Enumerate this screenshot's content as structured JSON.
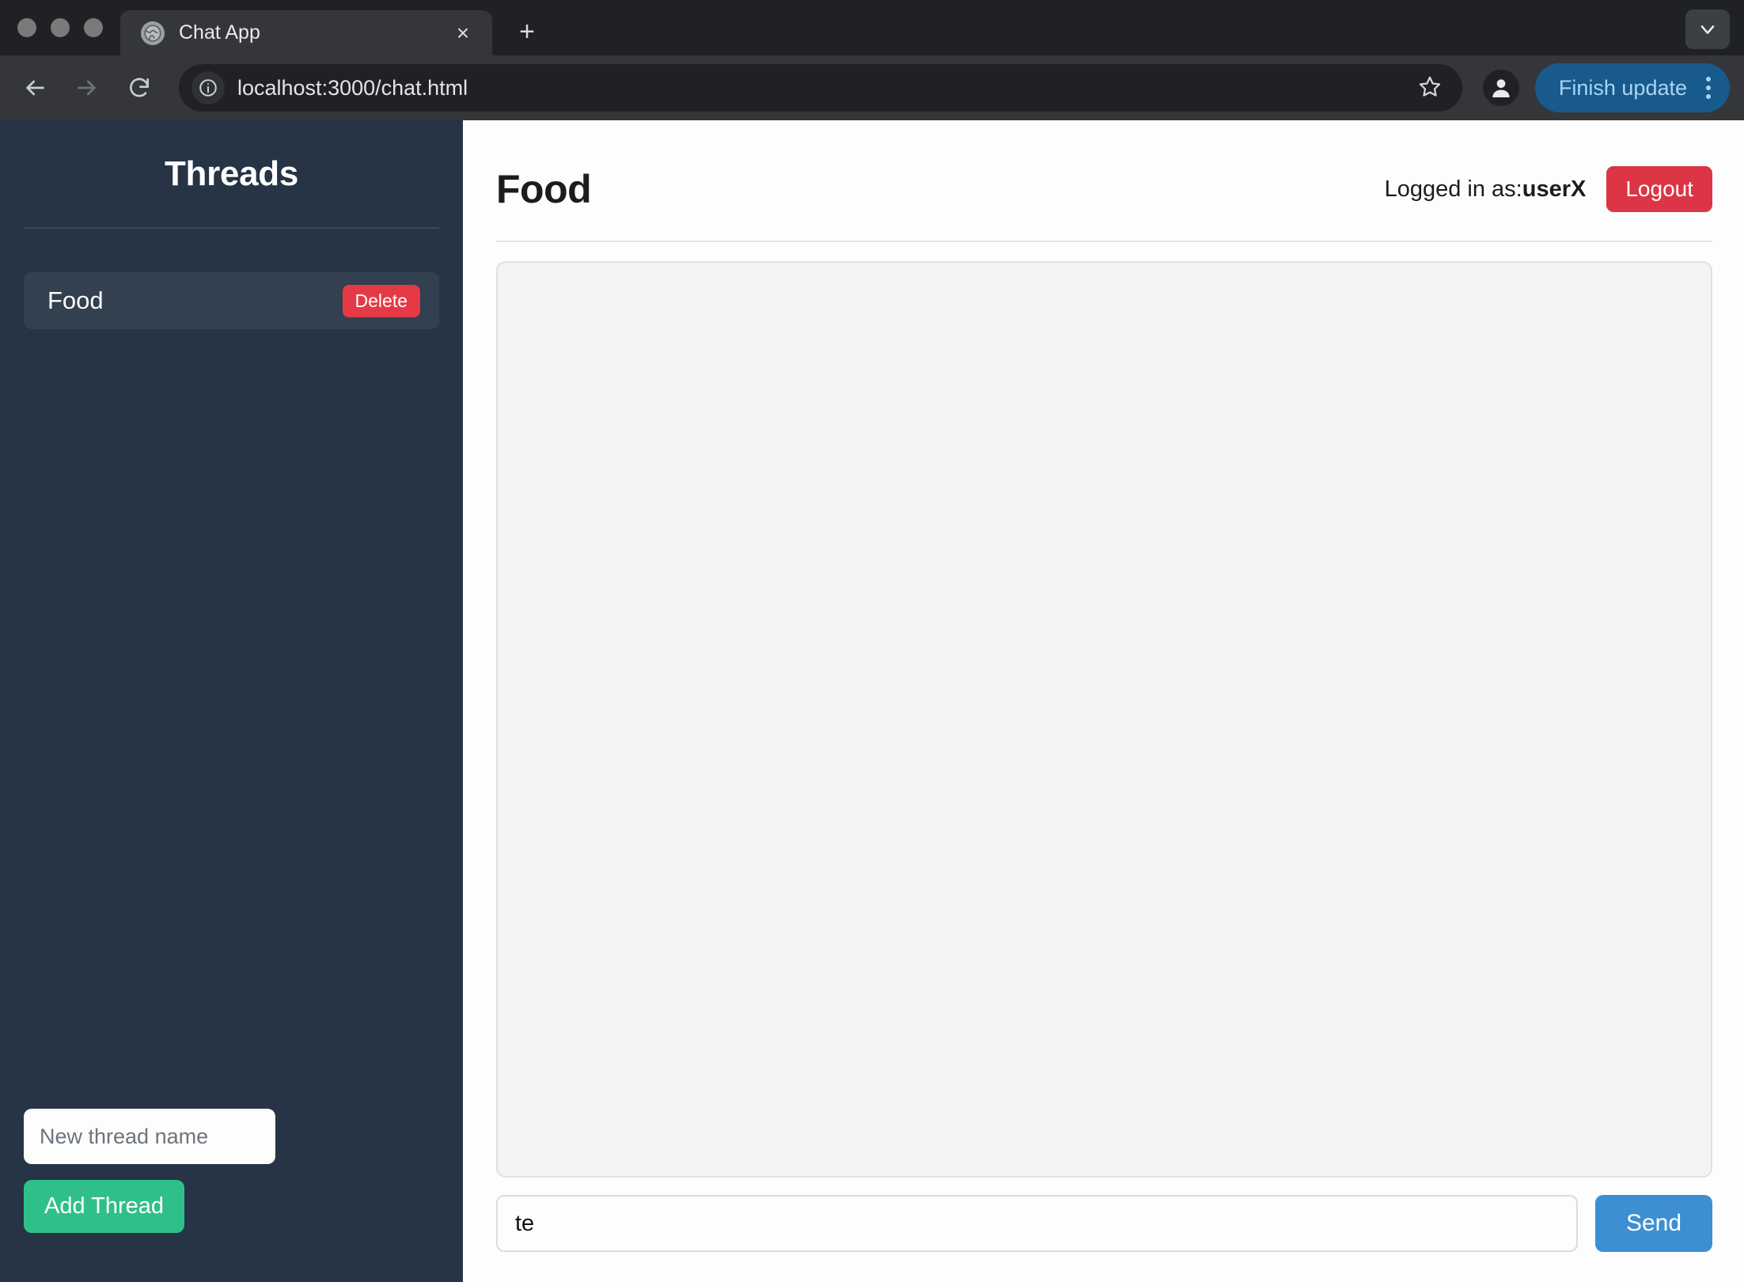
{
  "browser": {
    "traffic_lights": [
      "close",
      "minimize",
      "maximize"
    ],
    "tab": {
      "title": "Chat App",
      "favicon": "globe-icon",
      "close_label": "×"
    },
    "new_tab_label": "+",
    "tab_list_chevron": "chevron-down-icon",
    "toolbar": {
      "back": "back-arrow-icon",
      "forward": "forward-arrow-icon",
      "reload": "reload-icon",
      "site_info": "info-icon",
      "url": "localhost:3000/chat.html",
      "bookmark": "star-icon",
      "profile": "person-icon",
      "update_button_label": "Finish update",
      "menu": "kebab-menu-icon"
    }
  },
  "sidebar": {
    "title": "Threads",
    "threads": [
      {
        "name": "Food",
        "delete_label": "Delete"
      }
    ],
    "new_thread_placeholder": "New thread name",
    "new_thread_value": "",
    "add_thread_label": "Add Thread"
  },
  "main": {
    "title": "Food",
    "logged_in_prefix": "Logged in as:",
    "username": "userX",
    "logout_label": "Logout",
    "messages": [],
    "composer": {
      "value": "te",
      "placeholder": "",
      "send_label": "Send"
    }
  },
  "colors": {
    "sidebar_bg": "#263445",
    "thread_item_bg": "#32404f",
    "delete_red": "#e63946",
    "logout_red": "#dc3545",
    "add_thread_green": "#2fc08a",
    "send_blue": "#3d8fd1",
    "update_blue": "#185a8c",
    "messages_panel_bg": "#f4f4f4"
  }
}
